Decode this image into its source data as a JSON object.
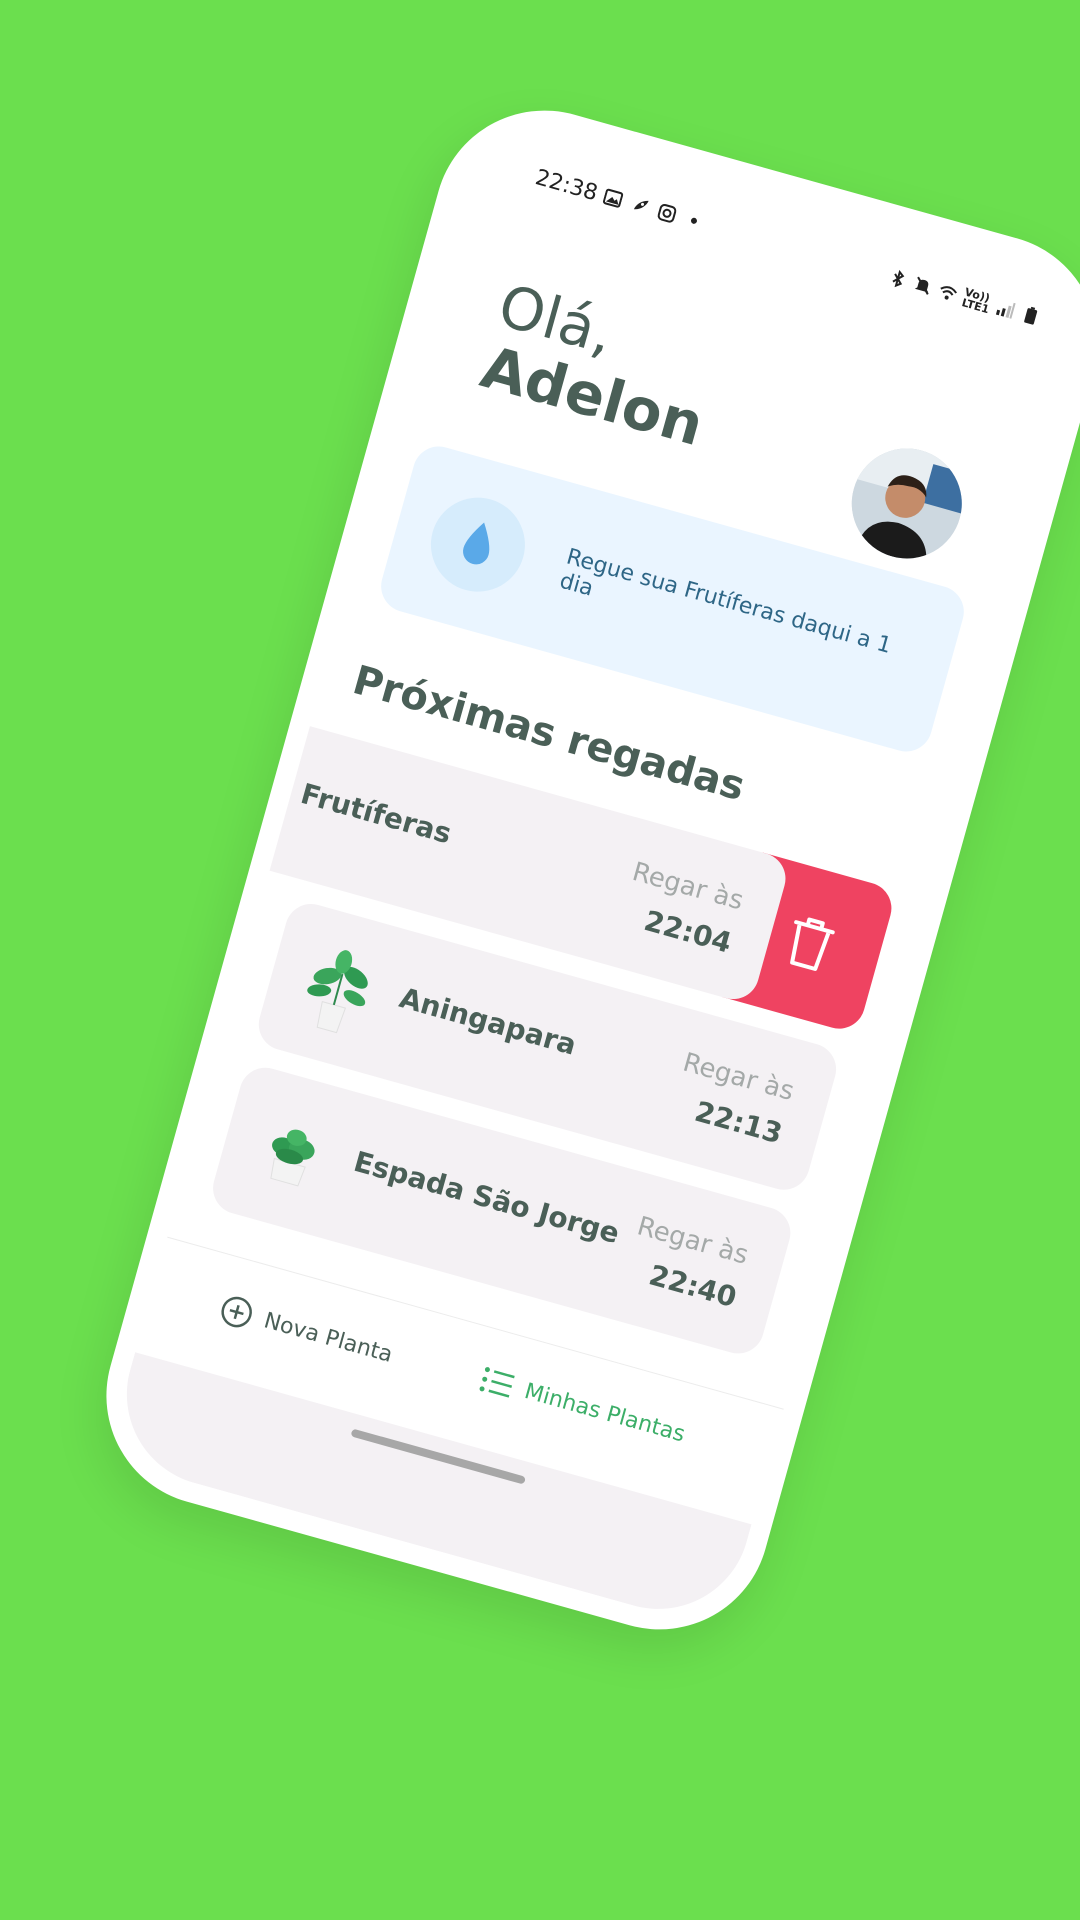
{
  "status_bar": {
    "time": "22:38",
    "network": "LTE1",
    "volte": "Vo))"
  },
  "greeting": {
    "hello": "Olá,",
    "name": "Adelon"
  },
  "banner": {
    "text": "Regue sua Frutíferas daqui a 1 dia"
  },
  "section_title": "Próximas regadas",
  "plants": [
    {
      "name": "Frutíferas",
      "label": "Regar às",
      "time": "22:04"
    },
    {
      "name": "Aningapara",
      "label": "Regar às",
      "time": "22:13"
    },
    {
      "name": "Espada São Jorge",
      "label": "Regar às",
      "time": "22:40"
    }
  ],
  "tabbar": {
    "new_plant": "Nova Planta",
    "my_plants": "Minhas Plantas"
  },
  "colors": {
    "background": "#6bdf4e",
    "accent_green": "#3cae68",
    "delete_red": "#ef4361",
    "text_dark": "#4a5f57",
    "banner_bg": "#eaf5ff",
    "card_bg": "#f4f1f4"
  },
  "icons": [
    "gallery-icon",
    "rocket-icon",
    "instagram-icon",
    "bluetooth-icon",
    "mute-icon",
    "wifi-icon",
    "signal-icon",
    "battery-icon",
    "water-drop-icon",
    "trash-icon",
    "add-circle-icon",
    "list-icon"
  ]
}
